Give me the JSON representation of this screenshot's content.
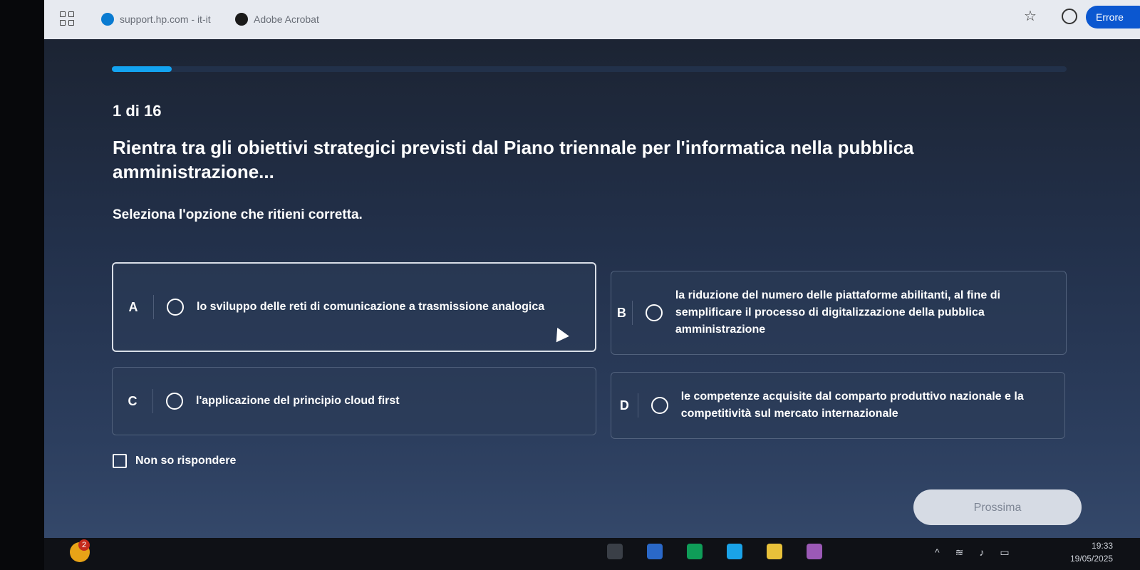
{
  "browser": {
    "bookmarks": [
      {
        "label": "support.hp.com - it-it",
        "icon": "hp-icon"
      },
      {
        "label": "Adobe Acrobat",
        "icon": "acrobat-icon"
      }
    ],
    "error_label": "Errore"
  },
  "quiz": {
    "progress": 0.0625,
    "counter": "1 di 16",
    "question": "Rientra tra gli obiettivi strategici previsti dal Piano triennale per l'informatica nella pubblica amministrazione...",
    "instruction": "Seleziona l'opzione che ritieni corretta.",
    "options": [
      {
        "letter": "A",
        "text": "lo sviluppo delle reti di comunicazione a trasmissione analogica"
      },
      {
        "letter": "B",
        "text": "la riduzione del numero delle piattaforme abilitanti, al fine di semplificare il processo di digitalizzazione della pubblica amministrazione"
      },
      {
        "letter": "C",
        "text": "l'applicazione del principio cloud first"
      },
      {
        "letter": "D",
        "text": "le competenze acquisite dal comparto produttivo nazionale e la competitività sul mercato internazionale"
      }
    ],
    "dont_know": "Non so rispondere",
    "next": "Prossima"
  },
  "taskbar": {
    "badge": "2",
    "time": "19:33",
    "date": "19/05/2025"
  }
}
